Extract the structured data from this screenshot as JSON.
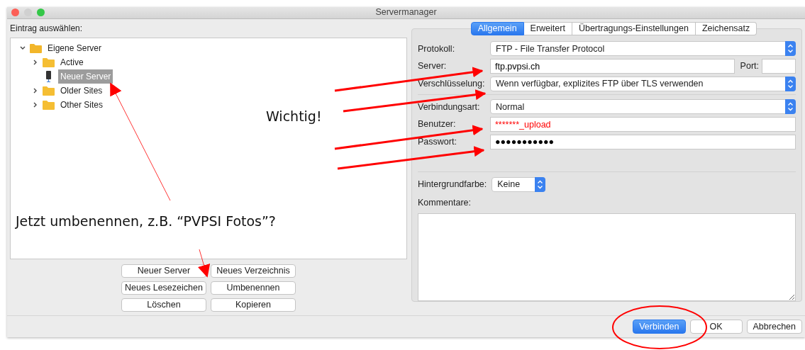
{
  "window": {
    "title": "Servermanager"
  },
  "entry_label": "Eintrag auswählen:",
  "tree": [
    {
      "label": "Eigene Server",
      "kind": "folder",
      "expanded": true,
      "selected": false,
      "children": [
        {
          "label": "Active",
          "kind": "folder",
          "expanded": false,
          "selected": false
        },
        {
          "label": "Neuer Server",
          "kind": "server",
          "selected": true
        },
        {
          "label": "Older Sites",
          "kind": "folder",
          "expanded": false,
          "selected": false
        },
        {
          "label": "Other Sites",
          "kind": "folder",
          "expanded": false,
          "selected": false
        }
      ]
    }
  ],
  "tree_buttons": [
    "Neuer Server",
    "Neues Verzeichnis",
    "Neues Lesezeichen",
    "Umbenennen",
    "Löschen",
    "Kopieren"
  ],
  "tabs": [
    {
      "label": "Allgemein",
      "selected": true
    },
    {
      "label": "Erweitert",
      "selected": false
    },
    {
      "label": "Übertragungs-Einstellungen",
      "selected": false
    },
    {
      "label": "Zeichensatz",
      "selected": false
    }
  ],
  "fields": [
    {
      "label": "Protokoll:",
      "kind": "select",
      "value": "FTP - File Transfer Protocol"
    },
    {
      "label": "Server:",
      "kind": "text",
      "value": "ftp.pvpsi.ch",
      "port_label": "Port:"
    },
    {
      "label": "Verschlüsselung:",
      "kind": "select",
      "value": "Wenn verfügbar, explizites FTP über TLS verwenden"
    },
    {
      "label": "Verbindungsart:",
      "kind": "select",
      "value": "Normal"
    },
    {
      "label": "Benutzer:",
      "kind": "text",
      "value": "*******_upload",
      "color": "#ff0000"
    },
    {
      "label": "Passwort:",
      "kind": "text",
      "value": "●●●●●●●●●●●"
    }
  ],
  "background_color": {
    "label": "Hintergrundfarbe:",
    "value": "Keine"
  },
  "comments_label": "Kommentare:",
  "dialog_buttons": [
    {
      "label": "Verbinden",
      "default": true
    },
    {
      "label": "OK",
      "default": false
    },
    {
      "label": "Abbrechen",
      "default": false
    }
  ],
  "annotations": [
    {
      "text": "Wichtig!"
    },
    {
      "text": "Jetzt umbenennen, z.B. “PVPSI Fotos”?"
    }
  ]
}
